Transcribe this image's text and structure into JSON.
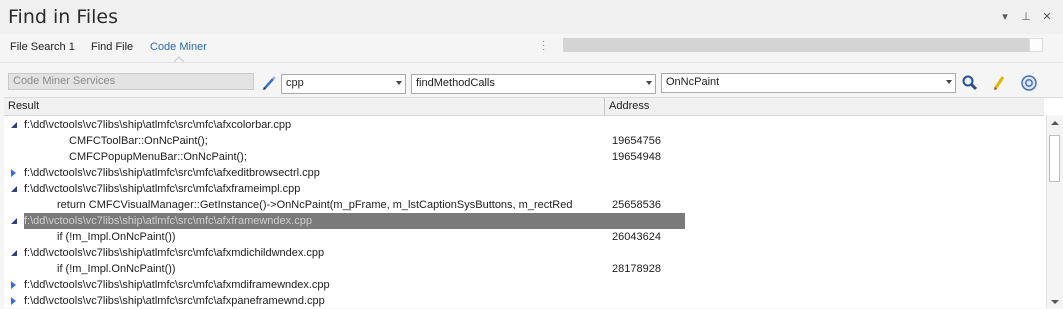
{
  "window": {
    "title": "Find in Files",
    "buttons": [
      {
        "name": "dropdown-icon",
        "glyph": "▾"
      },
      {
        "name": "pin-icon",
        "glyph": "⊥"
      },
      {
        "name": "close-icon",
        "glyph": "✕"
      }
    ]
  },
  "tabs": [
    "File Search 1",
    "Find File",
    "Code Miner"
  ],
  "active_tab": "Code Miner",
  "toolbar": {
    "services_placeholder": "Code Miner Services",
    "language": "cpp",
    "query": "findMethodCalls",
    "search_term": "OnNcPaint"
  },
  "columns": {
    "result": "Result",
    "address": "Address"
  },
  "rows": [
    {
      "type": "file",
      "expanded": true,
      "text": "f:\\dd\\vctools\\vc7libs\\ship\\atlmfc\\src\\mfc\\afxcolorbar.cpp",
      "address": ""
    },
    {
      "type": "match",
      "indent": 2,
      "text": "CMFCToolBar::OnNcPaint();",
      "address": "19654756"
    },
    {
      "type": "match",
      "indent": 2,
      "text": "CMFCPopupMenuBar::OnNcPaint();",
      "address": "19654948"
    },
    {
      "type": "file",
      "expanded": false,
      "text": "f:\\dd\\vctools\\vc7libs\\ship\\atlmfc\\src\\mfc\\afxeditbrowsectrl.cpp",
      "address": ""
    },
    {
      "type": "file",
      "expanded": true,
      "text": "f:\\dd\\vctools\\vc7libs\\ship\\atlmfc\\src\\mfc\\afxframeimpl.cpp",
      "address": ""
    },
    {
      "type": "match",
      "indent": 1,
      "text": "return CMFCVisualManager::GetInstance()->OnNcPaint(m_pFrame, m_lstCaptionSysButtons, m_rectRed",
      "address": "25658536"
    },
    {
      "type": "file",
      "expanded": true,
      "selected": true,
      "text": "f:\\dd\\vctools\\vc7libs\\ship\\atlmfc\\src\\mfc\\afxframewndex.cpp",
      "address": ""
    },
    {
      "type": "match",
      "indent": 1,
      "text": "if (!m_Impl.OnNcPaint())",
      "address": "26043624"
    },
    {
      "type": "file",
      "expanded": true,
      "text": "f:\\dd\\vctools\\vc7libs\\ship\\atlmfc\\src\\mfc\\afxmdichildwndex.cpp",
      "address": ""
    },
    {
      "type": "match",
      "indent": 1,
      "text": "if (!m_Impl.OnNcPaint())",
      "address": "28178928"
    },
    {
      "type": "file",
      "expanded": false,
      "text": "f:\\dd\\vctools\\vc7libs\\ship\\atlmfc\\src\\mfc\\afxmdiframewndex.cpp",
      "address": ""
    },
    {
      "type": "file",
      "expanded": false,
      "text": "f:\\dd\\vctools\\vc7libs\\ship\\atlmfc\\src\\mfc\\afxpaneframewnd.cpp",
      "address": ""
    }
  ],
  "colors": {
    "accent": "#2b6cb0",
    "selected_row": "#7a7a7a",
    "expander_collapsed": "#3d6fd6",
    "expander_expanded": "#2f3e7a"
  },
  "icons": {
    "pencil_blue": "pencil-icon",
    "search": "search-icon",
    "pencil_yellow": "highlight-icon",
    "help": "help-icon"
  }
}
